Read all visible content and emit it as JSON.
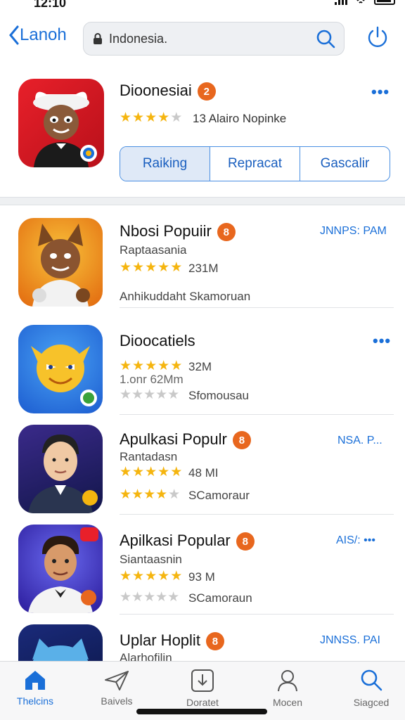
{
  "status": {
    "time": "12:10"
  },
  "nav": {
    "back_label": "Lanoh",
    "search_value": "Indonesia."
  },
  "hero": {
    "title": "Dioonesiai",
    "badge": "2",
    "rating_stars": 4,
    "rating_text": "13 Alairo Nopinke",
    "segments": [
      {
        "label": "Raiking",
        "active": true
      },
      {
        "label": "Repracat",
        "active": false
      },
      {
        "label": "Gascalir",
        "active": false
      }
    ]
  },
  "apps": [
    {
      "title": "Nbosi Popuiir",
      "badge": "8",
      "subtitle": "Raptaasania",
      "stars": 5,
      "size": "231M",
      "line3": "Anhikuddaht Skamoruan",
      "action": "JNNPS: PAM"
    },
    {
      "title": "Dioocatiels",
      "badge": "",
      "subtitle": "1.onr 62Mm",
      "stars": 5,
      "size": "32M",
      "line3": "Sfomousau",
      "action": "•••"
    },
    {
      "title": "Apulkasi Populr",
      "badge": "8",
      "subtitle": "Rantadasn",
      "stars": 5,
      "size": "48 MI",
      "line3": "SCamoraur",
      "action": "NSA. P..."
    },
    {
      "title": "Apilkasi Popular",
      "badge": "8",
      "subtitle": "Siantaasnin",
      "stars": 5,
      "size": "93 M",
      "line3": "SCamoraun",
      "action": "AIS/: •••"
    },
    {
      "title": "Uplar Hoplit",
      "badge": "8",
      "subtitle": "Alarhofilin",
      "stars": 0,
      "size": "",
      "line3": "",
      "action": "JNNSS. PAI"
    }
  ],
  "tabs": [
    {
      "label": "Thelcins",
      "icon": "home-icon",
      "active": true
    },
    {
      "label": "Baivels",
      "icon": "plane-icon",
      "active": false
    },
    {
      "label": "Doratet",
      "icon": "download-box-icon",
      "active": false
    },
    {
      "label": "Mocen",
      "icon": "person-icon",
      "active": false
    },
    {
      "label": "Siagced",
      "icon": "search-icon",
      "active": false
    }
  ],
  "colors": {
    "accent": "#1a6fd8",
    "badge": "#e8671e",
    "star": "#f5b50f"
  }
}
